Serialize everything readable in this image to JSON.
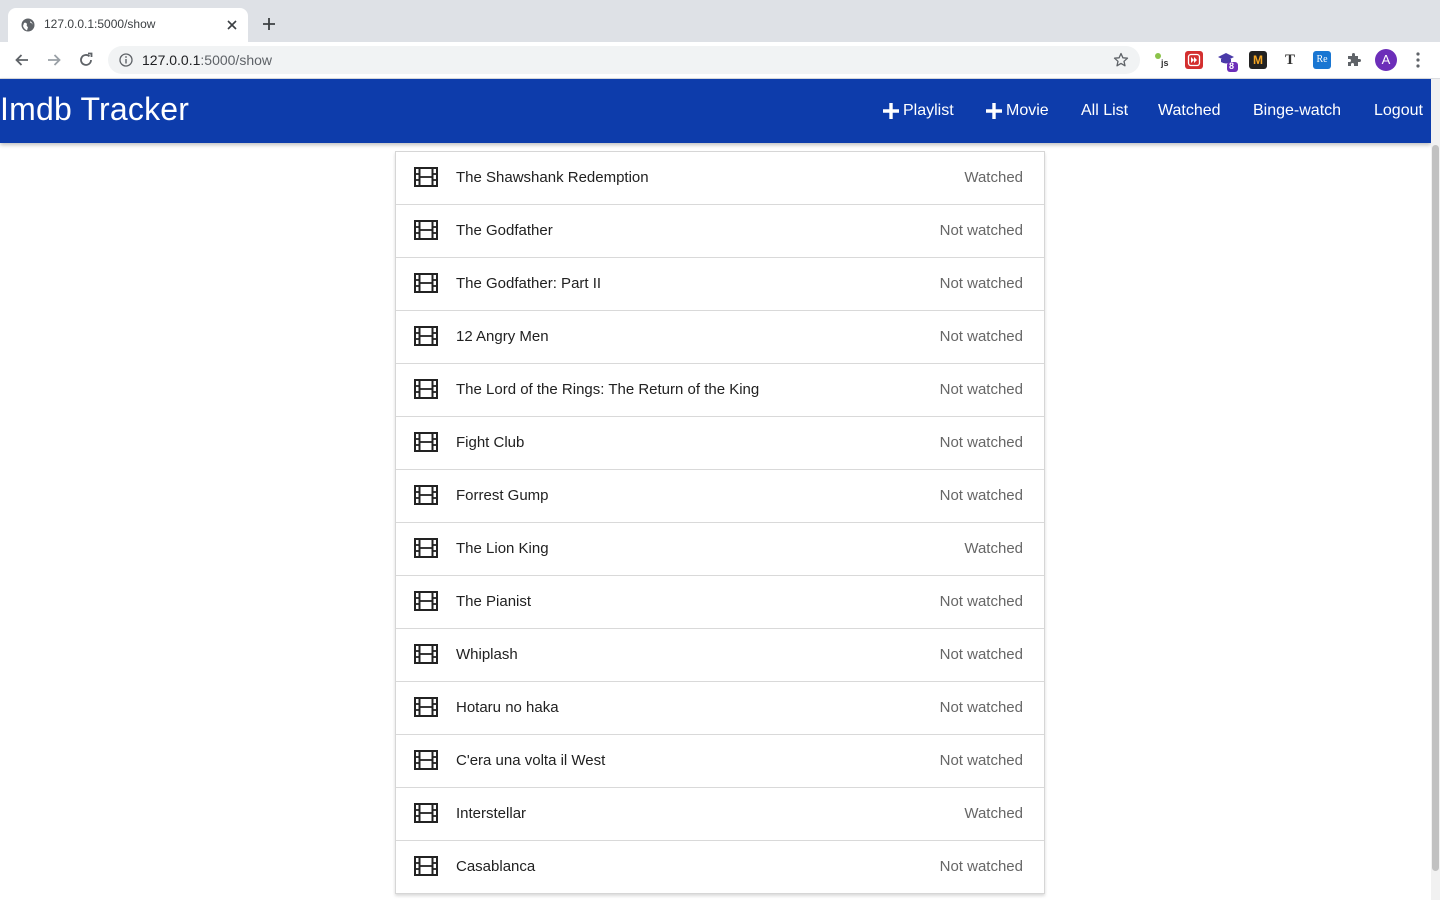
{
  "browser": {
    "tab_title": "127.0.0.1:5000/show",
    "url_host": "127.0.0.1",
    "url_path": ":5000/show",
    "ext_badge": "8",
    "avatar_letter": "A"
  },
  "app": {
    "brand": "Imdb Tracker",
    "nav": {
      "playlist": "Playlist",
      "movie": "Movie",
      "all_list": "All List",
      "watched": "Watched",
      "binge": "Binge-watch",
      "logout": "Logout"
    },
    "colors": {
      "navbar": "#0d3cab"
    }
  },
  "movies": [
    {
      "title": "The Shawshank Redemption",
      "status": "Watched"
    },
    {
      "title": "The Godfather",
      "status": "Not watched"
    },
    {
      "title": "The Godfather: Part II",
      "status": "Not watched"
    },
    {
      "title": "12 Angry Men",
      "status": "Not watched"
    },
    {
      "title": "The Lord of the Rings: The Return of the King",
      "status": "Not watched"
    },
    {
      "title": "Fight Club",
      "status": "Not watched"
    },
    {
      "title": "Forrest Gump",
      "status": "Not watched"
    },
    {
      "title": "The Lion King",
      "status": "Watched"
    },
    {
      "title": "The Pianist",
      "status": "Not watched"
    },
    {
      "title": "Whiplash",
      "status": "Not watched"
    },
    {
      "title": "Hotaru no haka",
      "status": "Not watched"
    },
    {
      "title": "C'era una volta il West",
      "status": "Not watched"
    },
    {
      "title": "Interstellar",
      "status": "Watched"
    },
    {
      "title": "Casablanca",
      "status": "Not watched"
    }
  ]
}
